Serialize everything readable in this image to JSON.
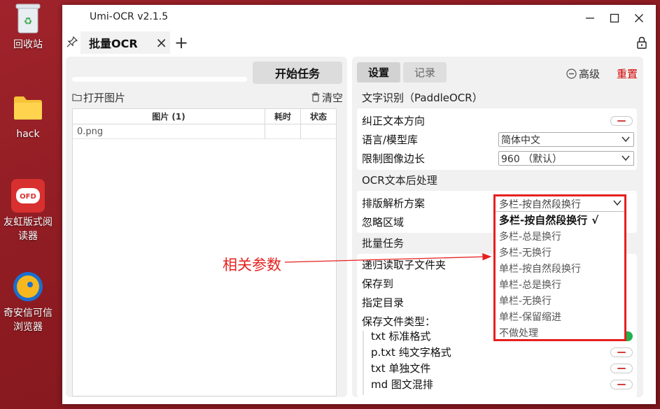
{
  "desktop": {
    "icons": [
      {
        "name": "recycle-bin",
        "label": "回收站"
      },
      {
        "name": "hack-folder",
        "label": "hack"
      },
      {
        "name": "youhong-reader",
        "label": "友虹版式阅读器"
      },
      {
        "name": "qianxin-browser",
        "label": "奇安信可信浏览器"
      }
    ]
  },
  "window": {
    "title": "Umi-OCR v2.1.5",
    "tab_label": "批量OCR"
  },
  "left": {
    "start_button": "开始任务",
    "open_images": "打开图片",
    "clear": "清空",
    "columns": [
      "图片 (1)",
      "耗时",
      "状态"
    ],
    "rows": [
      {
        "file": "0.png",
        "time": "",
        "status": ""
      }
    ]
  },
  "right": {
    "tabs": [
      "设置",
      "记录"
    ],
    "advanced": "高级",
    "reset": "重置",
    "section_ocr": "文字识别（PaddleOCR）",
    "correct_direction": "纠正文本方向",
    "language_label": "语言/模型库",
    "language_value": "简体中文",
    "limit_label": "限制图像边长",
    "limit_value": "960 （默认）",
    "section_post": "OCR文本后处理",
    "layout_label": "排版解析方案",
    "ignore_label": "忽略区域",
    "section_batch": "批量任务",
    "recursive_label": "递归读取子文件夹",
    "save_to_label": "保存到",
    "specify_dir_label": "指定目录",
    "save_types_label": "保存文件类型：",
    "save_types": [
      {
        "label": "txt 标准格式",
        "on": true
      },
      {
        "label": "p.txt 纯文字格式",
        "on": false
      },
      {
        "label": "txt 单独文件",
        "on": false
      },
      {
        "label": "md 图文混排",
        "on": false
      }
    ]
  },
  "dropdown": {
    "current": "多栏-按自然段换行",
    "options": [
      {
        "label": "多栏-按自然段换行",
        "selected_mark": "√"
      },
      {
        "label": "多栏-总是换行"
      },
      {
        "label": "多栏-无换行"
      },
      {
        "label": "单栏-按自然段换行"
      },
      {
        "label": "单栏-总是换行"
      },
      {
        "label": "单栏-无换行"
      },
      {
        "label": "单栏-保留缩进"
      },
      {
        "label": "不做处理"
      }
    ]
  },
  "annotation": {
    "text": "相关参数",
    "color": "#e52020"
  }
}
